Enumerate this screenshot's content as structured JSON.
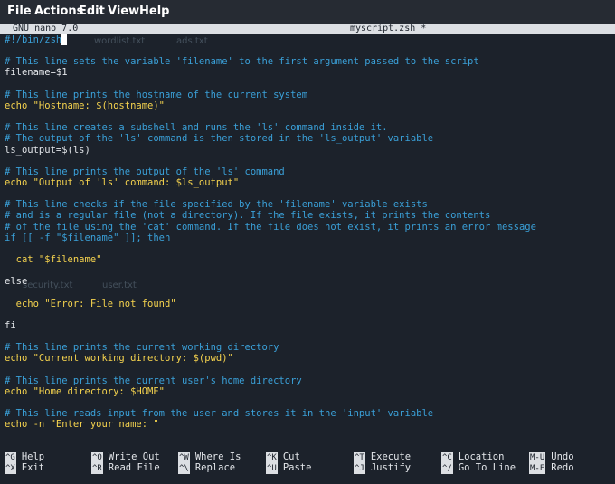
{
  "menubar": {
    "items": [
      "File",
      "Actions",
      "Edit",
      "View",
      "Help"
    ]
  },
  "titlebar": {
    "left": "GNU nano 7.0",
    "right": "myscript.zsh *"
  },
  "background_labels": [
    "wordlist.txt",
    "ads.txt",
    "security.txt",
    "user.txt"
  ],
  "editor": {
    "lines": [
      {
        "text": "#!/bin/zsh",
        "cls": "c",
        "cursor": true
      },
      {
        "text": "",
        "cls": ""
      },
      {
        "text": "# This line sets the variable 'filename' to the first argument passed to the script",
        "cls": "c"
      },
      {
        "text": "filename=$1",
        "cls": ""
      },
      {
        "text": "",
        "cls": ""
      },
      {
        "text": "# This line prints the hostname of the current system",
        "cls": "c"
      },
      {
        "text": "echo \"Hostname: $(hostname)\"",
        "cls": "y"
      },
      {
        "text": "",
        "cls": ""
      },
      {
        "text": "# This line creates a subshell and runs the 'ls' command inside it.",
        "cls": "c"
      },
      {
        "text": "# The output of the 'ls' command is then stored in the 'ls_output' variable",
        "cls": "c"
      },
      {
        "text": "ls_output=$(ls)",
        "cls": ""
      },
      {
        "text": "",
        "cls": ""
      },
      {
        "text": "# This line prints the output of the 'ls' command",
        "cls": "c"
      },
      {
        "text": "echo \"Output of 'ls' command: $ls_output\"",
        "cls": "y"
      },
      {
        "text": "",
        "cls": ""
      },
      {
        "text": "# This line checks if the file specified by the 'filename' variable exists",
        "cls": "c"
      },
      {
        "text": "# and is a regular file (not a directory). If the file exists, it prints the contents",
        "cls": "c"
      },
      {
        "text": "# of the file using the 'cat' command. If the file does not exist, it prints an error message",
        "cls": "c"
      },
      {
        "text": "if [[ -f \"$filename\" ]]; then",
        "cls": "c"
      },
      {
        "text": "",
        "cls": ""
      },
      {
        "text": "  cat \"$filename\"",
        "cls": "y"
      },
      {
        "text": "",
        "cls": ""
      },
      {
        "text": "else",
        "cls": ""
      },
      {
        "text": "",
        "cls": ""
      },
      {
        "text": "  echo \"Error: File not found\"",
        "cls": "y"
      },
      {
        "text": "",
        "cls": ""
      },
      {
        "text": "fi",
        "cls": ""
      },
      {
        "text": "",
        "cls": ""
      },
      {
        "text": "# This line prints the current working directory",
        "cls": "c"
      },
      {
        "text": "echo \"Current working directory: $(pwd)\"",
        "cls": "y"
      },
      {
        "text": "",
        "cls": ""
      },
      {
        "text": "# This line prints the current user's home directory",
        "cls": "c"
      },
      {
        "text": "echo \"Home directory: $HOME\"",
        "cls": "y"
      },
      {
        "text": "",
        "cls": ""
      },
      {
        "text": "# This line reads input from the user and stores it in the 'input' variable",
        "cls": "c"
      },
      {
        "text": "echo -n \"Enter your name: \"",
        "cls": "y"
      }
    ]
  },
  "shortcuts": [
    {
      "key": "^G",
      "label": "Help"
    },
    {
      "key": "^X",
      "label": "Exit"
    },
    {
      "key": "^O",
      "label": "Write Out"
    },
    {
      "key": "^R",
      "label": "Read File"
    },
    {
      "key": "^W",
      "label": "Where Is"
    },
    {
      "key": "^\\",
      "label": "Replace"
    },
    {
      "key": "^K",
      "label": "Cut"
    },
    {
      "key": "^U",
      "label": "Paste"
    },
    {
      "key": "^T",
      "label": "Execute"
    },
    {
      "key": "^J",
      "label": "Justify"
    },
    {
      "key": "^C",
      "label": "Location"
    },
    {
      "key": "^/",
      "label": "Go To Line"
    },
    {
      "key": "M-U",
      "label": "Undo"
    },
    {
      "key": "M-E",
      "label": "Redo"
    }
  ]
}
